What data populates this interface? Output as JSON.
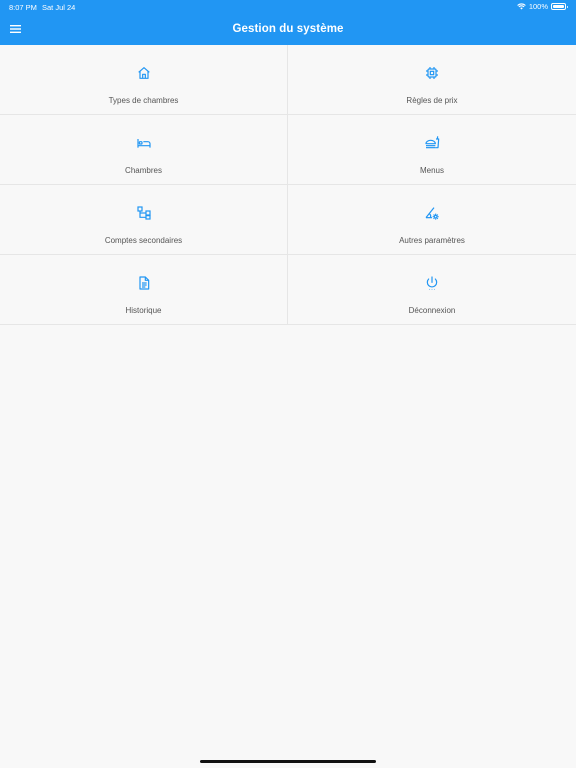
{
  "status_bar": {
    "time": "8:07 PM",
    "date": "Sat Jul 24",
    "battery": "100%"
  },
  "app_bar": {
    "title": "Gestion du système"
  },
  "menu": [
    {
      "label": "Types de chambres",
      "icon": "home-icon"
    },
    {
      "label": "Règles de prix",
      "icon": "chip-icon"
    },
    {
      "label": "Chambres",
      "icon": "bed-icon"
    },
    {
      "label": "Menus",
      "icon": "food-icon"
    },
    {
      "label": "Comptes secondaires",
      "icon": "hierarchy-icon"
    },
    {
      "label": "Autres paramètres",
      "icon": "settings-angle-icon"
    },
    {
      "label": "Historique",
      "icon": "document-icon"
    },
    {
      "label": "Déconnexion",
      "icon": "power-icon"
    }
  ],
  "colors": {
    "accent": "#2196f3",
    "background": "#f8f8f8",
    "divider": "#e6e6e6",
    "label": "#555555"
  }
}
